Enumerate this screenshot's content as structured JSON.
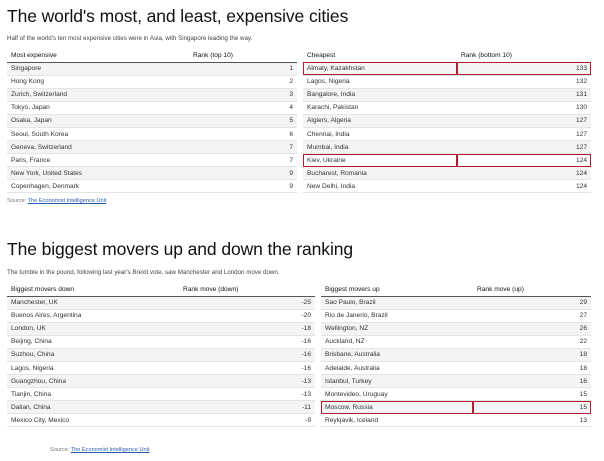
{
  "section1": {
    "title": "The world's most, and least, expensive cities",
    "subtitle": "Half of the world's ten most expensive cities were in Asia, with Singapore leading the way.",
    "headers": [
      "Most expensive",
      "Rank (top 10)",
      "Cheapest",
      "Rank (bottom 10)"
    ],
    "rows": [
      {
        "left": "Singapore",
        "left_rank": "1",
        "right": "Almaty, Kazakhstan",
        "right_rank": "133",
        "highlight": true
      },
      {
        "left": "Hong Kong",
        "left_rank": "2",
        "right": "Lagos, Nigeria",
        "right_rank": "132",
        "highlight": false
      },
      {
        "left": "Zurich, Switzerland",
        "left_rank": "3",
        "right": "Bangalore, India",
        "right_rank": "131",
        "highlight": false
      },
      {
        "left": "Tokyo, Japan",
        "left_rank": "4",
        "right": "Karachi, Pakistan",
        "right_rank": "130",
        "highlight": false
      },
      {
        "left": "Osaka, Japan",
        "left_rank": "5",
        "right": "Algiers, Algeria",
        "right_rank": "127",
        "highlight": false
      },
      {
        "left": "Seoul, South Korea",
        "left_rank": "6",
        "right": "Chennai, India",
        "right_rank": "127",
        "highlight": false
      },
      {
        "left": "Geneva, Switzerland",
        "left_rank": "7",
        "right": "Mumbai, India",
        "right_rank": "127",
        "highlight": false
      },
      {
        "left": "Paris, France",
        "left_rank": "7",
        "right": "Kiev, Ukraine",
        "right_rank": "124",
        "highlight": true
      },
      {
        "left": "New York, United States",
        "left_rank": "9",
        "right": "Bucharest, Romania",
        "right_rank": "124",
        "highlight": false
      },
      {
        "left": "Copenhagen, Denmark",
        "left_rank": "9",
        "right": "New Delhi, India",
        "right_rank": "124",
        "highlight": false
      }
    ],
    "source_label": "Source:",
    "source_link": "The Economist Intelligence Unit"
  },
  "section2": {
    "title": "The biggest movers up and down the ranking",
    "subtitle": "The tumble in the pound, following last year's Brexit vote, saw Manchester and London move down.",
    "headers": [
      "Biggest movers down",
      "Rank move (down)",
      "Biggest movers up",
      "Rank move (up)"
    ],
    "rows": [
      {
        "left": "Manchester, UK",
        "left_rank": "-25",
        "right": "Sao Paulo, Brazil",
        "right_rank": "29",
        "highlight": false
      },
      {
        "left": "Buenos Aires, Argentina",
        "left_rank": "-20",
        "right": "Rio de Janerio, Brazil",
        "right_rank": "27",
        "highlight": false
      },
      {
        "left": "London, UK",
        "left_rank": "-18",
        "right": "Wellington, NZ",
        "right_rank": "26",
        "highlight": false
      },
      {
        "left": "Beijing, China",
        "left_rank": "-16",
        "right": "Auckland, NZ",
        "right_rank": "22",
        "highlight": false
      },
      {
        "left": "Suzhou, China",
        "left_rank": "-16",
        "right": "Brisbane, Australia",
        "right_rank": "18",
        "highlight": false
      },
      {
        "left": "Lagos, Nigeria",
        "left_rank": "-16",
        "right": "Adelaide, Australia",
        "right_rank": "18",
        "highlight": false
      },
      {
        "left": "Guangzhou, China",
        "left_rank": "-13",
        "right": "Istanbul, Turkey",
        "right_rank": "16",
        "highlight": false
      },
      {
        "left": "Tianjin, China",
        "left_rank": "-13",
        "right": "Montevideo, Uruguay",
        "right_rank": "15",
        "highlight": false
      },
      {
        "left": "Dalian, China",
        "left_rank": "-11",
        "right": "Moscow, Russia",
        "right_rank": "15",
        "highlight": true
      },
      {
        "left": "Mexico City, Mexico",
        "left_rank": "-9",
        "right": "Reykjavik, Iceland",
        "right_rank": "13",
        "highlight": false
      }
    ],
    "source_label": "Source:",
    "source_link": "The Economist Intelligence Unit"
  },
  "colors": {
    "highlight": "#b01e2f",
    "link": "#2a5db0",
    "row_shade": "#f4f4f4"
  }
}
